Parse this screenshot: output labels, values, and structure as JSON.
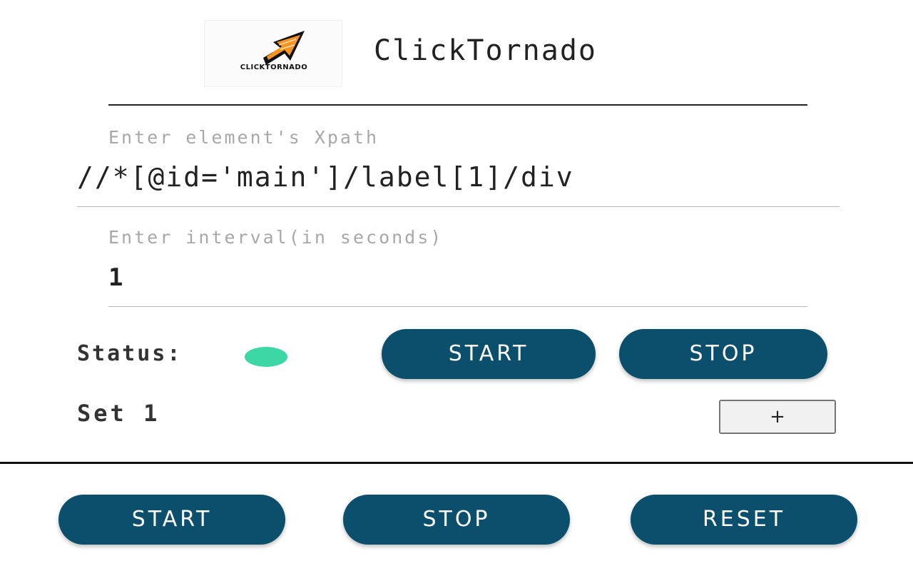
{
  "header": {
    "logo_caption": "CLICKTORNADO",
    "title": "ClickTornado"
  },
  "set": {
    "xpath_placeholder": "Enter element's Xpath",
    "xpath_value": "//*[@id='main']/label[1]/div",
    "interval_placeholder": "Enter interval(in seconds)",
    "interval_value": "1",
    "status_label": "Status:",
    "status_color": "#3dd6a5",
    "start_label": "START",
    "stop_label": "STOP",
    "set_name": "Set 1",
    "add_label": "+"
  },
  "global": {
    "start_label": "START",
    "stop_label": "STOP",
    "reset_label": "RESET"
  },
  "colors": {
    "button_bg": "#0b4f6c",
    "logo_orange": "#f7941d"
  }
}
